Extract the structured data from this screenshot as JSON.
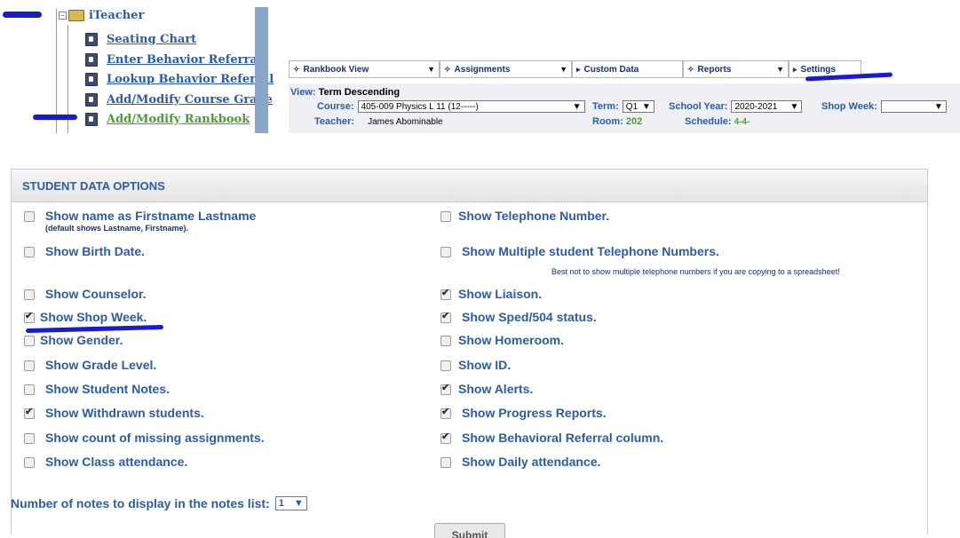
{
  "tree": {
    "root_label": "iTeacher",
    "items": [
      {
        "label": "Seating Chart"
      },
      {
        "label": "Enter Behavior Referral"
      },
      {
        "label": "Lookup Behavior Referral"
      },
      {
        "label": "Add/Modify Course Grade"
      },
      {
        "label": "Add/Modify Rankbook"
      }
    ]
  },
  "menu": {
    "rankbook_view": "Rankbook View",
    "assignments": "Assignments",
    "custom_data": "Custom Data",
    "reports": "Reports",
    "settings": "Settings"
  },
  "header": {
    "view_label": "View:",
    "view_value": "Term Descending",
    "course_label": "Course:",
    "course_value": "405-009 Physics L 11 (12-----)",
    "term_label": "Term:",
    "term_value": "Q1",
    "school_year_label": "School Year:",
    "school_year_value": "2020-2021",
    "shop_week_label": "Shop Week:",
    "shop_week_value": "",
    "teacher_label": "Teacher:",
    "teacher_value": "James Abominable",
    "room_label": "Room:",
    "room_value": "202",
    "schedule_label": "Schedule:",
    "schedule_value": "4-4-"
  },
  "panel": {
    "title": "STUDENT DATA OPTIONS",
    "left": [
      {
        "label": "Show name as Firstname Lastname",
        "checked": false,
        "sub": "(default shows Lastname, Firstname)."
      },
      {
        "label": "Show Birth Date.",
        "checked": false
      },
      {
        "label": "Show Counselor.",
        "checked": false
      },
      {
        "label": "Show Shop Week.",
        "checked": true
      },
      {
        "label": "Show Gender.",
        "checked": false
      },
      {
        "label": "Show Grade Level.",
        "checked": false
      },
      {
        "label": "Show Student Notes.",
        "checked": false
      },
      {
        "label": "Show Withdrawn students.",
        "checked": true
      },
      {
        "label": "Show count of missing assignments.",
        "checked": false
      },
      {
        "label": "Show Class attendance.",
        "checked": false
      }
    ],
    "right": [
      {
        "label": "Show Telephone Number.",
        "checked": false
      },
      {
        "label": "Show Multiple student Telephone Numbers.",
        "checked": false
      },
      {
        "label": "Show Liaison.",
        "checked": true
      },
      {
        "label": "Show Sped/504 status.",
        "checked": true
      },
      {
        "label": "Show Homeroom.",
        "checked": false
      },
      {
        "label": "Show ID.",
        "checked": false
      },
      {
        "label": "Show Alerts.",
        "checked": true
      },
      {
        "label": "Show Progress Reports.",
        "checked": true
      },
      {
        "label": "Show Behavioral Referral column.",
        "checked": true
      },
      {
        "label": "Show Daily attendance.",
        "checked": false
      }
    ],
    "phone_note": "Best not to show multiple telephone numbers if you are copying to a spreadsheet!",
    "notes_label": "Number of notes to display in the notes list:",
    "notes_value": "1",
    "submit_label": "Submit"
  }
}
